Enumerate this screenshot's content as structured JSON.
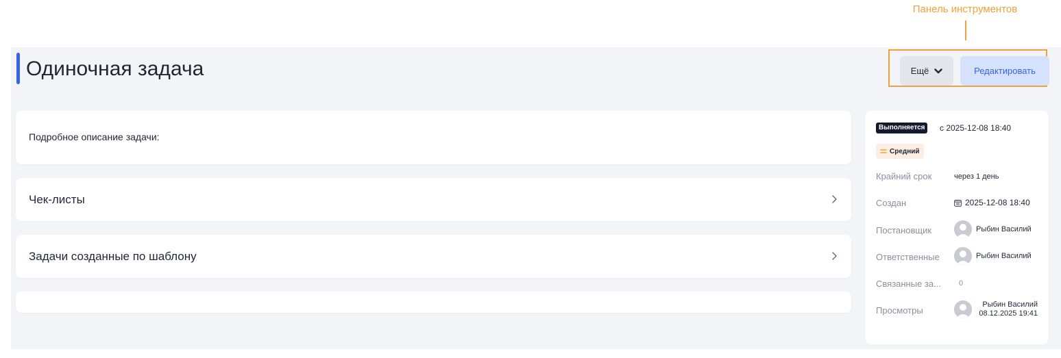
{
  "annotation": {
    "label": "Панель инструментов"
  },
  "page": {
    "title": "Одиночная задача"
  },
  "toolbar": {
    "more_label": "Ещё",
    "edit_label": "Редактировать"
  },
  "content": {
    "description_label": "Подробное описание задачи:",
    "checklists_label": "Чек-листы",
    "template_tasks_label": "Задачи созданные по шаблону"
  },
  "sidebar": {
    "status_badge": "Выполняется",
    "status_since": "с 2025-12-08 18:40",
    "priority": "Средний",
    "deadline_label": "Крайний срок",
    "deadline_value": "через 1 день",
    "created_label": "Создан",
    "created_value": "2025-12-08 18:40",
    "author_label": "Постановщик",
    "author_name": "Рыбин Василий",
    "responsible_label": "Ответственные",
    "responsible_name": "Рыбин Василий",
    "related_label": "Связанные за...",
    "related_count": "0",
    "views_label": "Просмотры",
    "views_name": "Рыбин Василий",
    "views_time": "08.12.2025 19:41"
  },
  "colors": {
    "accent": "#3563e9",
    "annotation": "#f2a03b",
    "status_badge_bg": "#141a2e",
    "priority_bg": "#fdeee3",
    "priority_icon": "#f2a03b"
  },
  "icons": [
    "chevron-down-icon",
    "chevron-right-icon",
    "priority-medium-icon",
    "calendar-icon",
    "avatar-icon"
  ]
}
